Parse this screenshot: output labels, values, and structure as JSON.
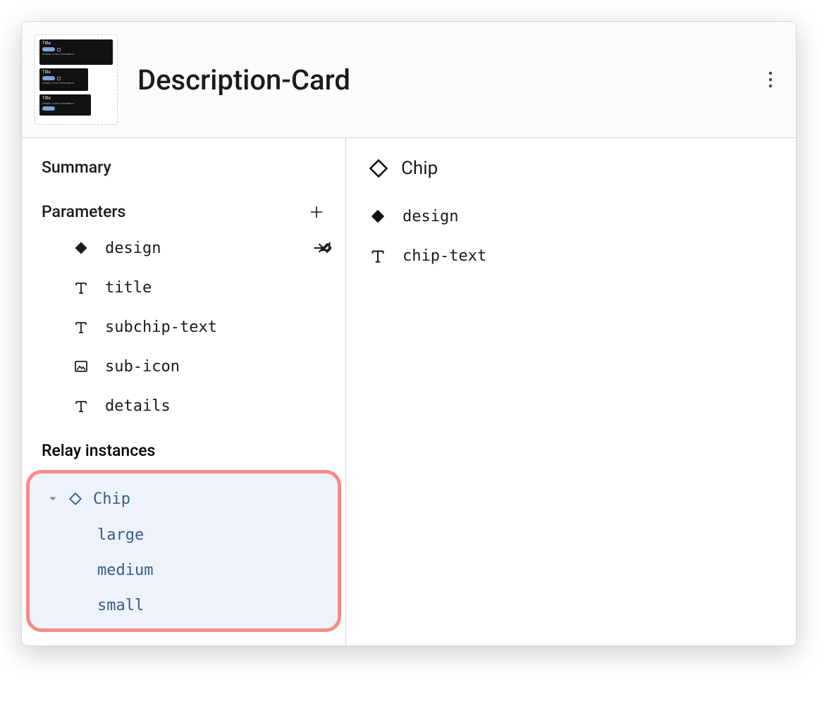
{
  "header": {
    "title": "Description-Card"
  },
  "left": {
    "summary_label": "Summary",
    "parameters_label": "Parameters",
    "parameters": [
      {
        "icon": "diamond-filled",
        "name": "design",
        "has_action": true
      },
      {
        "icon": "text",
        "name": "title",
        "has_action": false
      },
      {
        "icon": "text",
        "name": "subchip-text",
        "has_action": false
      },
      {
        "icon": "image",
        "name": "sub-icon",
        "has_action": false
      },
      {
        "icon": "text",
        "name": "details",
        "has_action": false
      }
    ],
    "relay_label": "Relay instances",
    "relay_instance": {
      "name": "Chip",
      "variants": [
        "large",
        "medium",
        "small"
      ]
    }
  },
  "right": {
    "component_name": "Chip",
    "properties": [
      {
        "icon": "diamond-filled",
        "name": "design"
      },
      {
        "icon": "text",
        "name": "chip-text"
      }
    ]
  }
}
